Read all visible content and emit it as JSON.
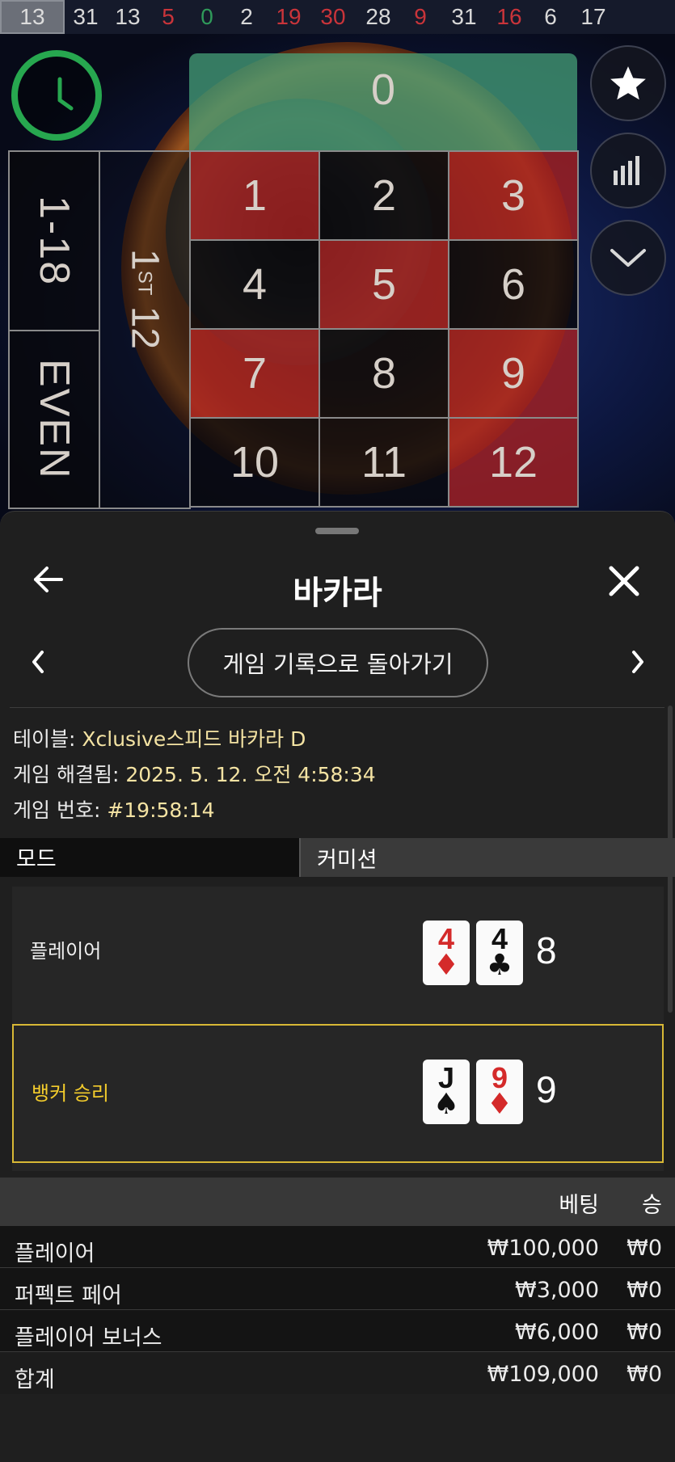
{
  "history": [
    {
      "n": "13",
      "color": "current"
    },
    {
      "n": "31",
      "color": "black"
    },
    {
      "n": "13",
      "color": "black"
    },
    {
      "n": "5",
      "color": "red"
    },
    {
      "n": "0",
      "color": "green"
    },
    {
      "n": "2",
      "color": "black"
    },
    {
      "n": "19",
      "color": "red"
    },
    {
      "n": "30",
      "color": "red"
    },
    {
      "n": "28",
      "color": "black"
    },
    {
      "n": "9",
      "color": "red"
    },
    {
      "n": "31",
      "color": "black"
    },
    {
      "n": "16",
      "color": "red"
    },
    {
      "n": "6",
      "color": "black"
    },
    {
      "n": "17",
      "color": "black"
    }
  ],
  "board": {
    "zero": "0",
    "low": "1-18",
    "even": "EVEN",
    "dozen_num": "1",
    "dozen_sup": "ST",
    "dozen_end": "12",
    "numbers": [
      "1",
      "2",
      "3",
      "4",
      "5",
      "6",
      "7",
      "8",
      "9",
      "10",
      "11",
      "12"
    ]
  },
  "controls": [
    "favorites-star-icon",
    "statistics-bars-icon",
    "collapse-chevron-icon"
  ],
  "sheet": {
    "title": "바카라",
    "back_pill": "게임 기록으로 돌아가기",
    "table_label": "테이블:",
    "table_value": "Xclusive스피드 바카라 D",
    "resolved_label": "게임 해결됨:",
    "resolved_value": "2025. 5. 12. 오전 4:58:34",
    "game_no_label": "게임 번호:",
    "game_no_value": "#19:58:14",
    "tabs": [
      "모드",
      "커미션"
    ],
    "player": {
      "label": "플레이어",
      "cards": [
        {
          "rank": "4",
          "suit": "♦"
        },
        {
          "rank": "4",
          "suit": "♣"
        }
      ],
      "score": "8"
    },
    "banker": {
      "label": "뱅커 승리",
      "cards": [
        {
          "rank": "J",
          "suit": "♠"
        },
        {
          "rank": "9",
          "suit": "♦"
        }
      ],
      "score": "9"
    },
    "bets_header": {
      "bet": "베팅",
      "win": "승"
    },
    "bets": [
      {
        "label": "플레이어",
        "bet": "₩100,000",
        "win": "₩0"
      },
      {
        "label": "퍼펙트 페어",
        "bet": "₩3,000",
        "win": "₩0"
      },
      {
        "label": "플레이어 보너스",
        "bet": "₩6,000",
        "win": "₩0"
      }
    ],
    "total": {
      "label": "합계",
      "bet": "₩109,000",
      "win": "₩0"
    }
  },
  "colors": {
    "accent_win": "#f3cc2c",
    "info_value": "#f4e3a3",
    "timer_green": "#27a74f"
  }
}
